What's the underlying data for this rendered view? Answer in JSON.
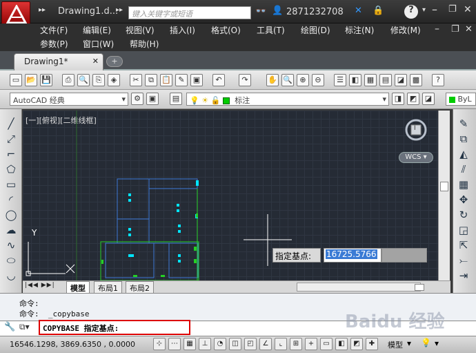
{
  "title": {
    "doc": "Drawing1.d...",
    "search_placeholder": "键入关键字或短语",
    "user": "2871232708"
  },
  "menu": [
    "文件(F)",
    "编辑(E)",
    "视图(V)",
    "插入(I)",
    "格式(O)",
    "工具(T)",
    "绘图(D)",
    "标注(N)",
    "修改(M)",
    "参数(P)",
    "窗口(W)",
    "帮助(H)"
  ],
  "tab": {
    "name": "Drawing1*"
  },
  "workspace": "AutoCAD 经典",
  "layer": "标注",
  "bylayer": "ByL",
  "viewport_label": "[一][俯视][二维线框]",
  "wcs": "WCS",
  "compass": {
    "top": "I"
  },
  "ucs": {
    "x": "X",
    "y": "Y"
  },
  "prompt": {
    "label": "指定基点:",
    "value": "16725.5766"
  },
  "layouts": [
    "模型",
    "布局1",
    "布局2"
  ],
  "cmd_history": [
    "命令:",
    "命令:  _copybase"
  ],
  "cmd_current": "COPYBASE 指定基点:",
  "coords": "16546.1298, 3869.6350 , 0.0000",
  "status_model": "模型",
  "watermark": "Baidu 经验",
  "colors": {
    "accent": "#d00000",
    "canvas": "#252b35",
    "highlight": "#3a7bd5"
  }
}
